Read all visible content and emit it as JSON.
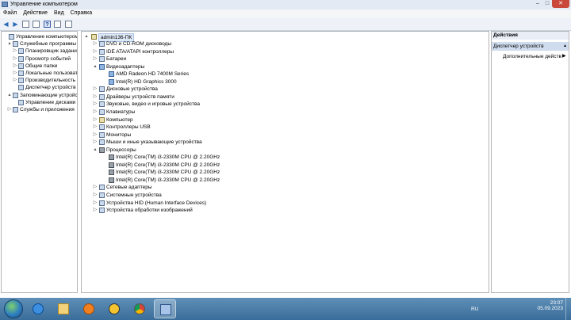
{
  "window": {
    "title": "Управление компьютером"
  },
  "menu": [
    "Файл",
    "Действие",
    "Вид",
    "Справка"
  ],
  "left_tree": [
    {
      "label": "Управление компьютером (л",
      "exp": "",
      "level": 0
    },
    {
      "label": "Служебные программы",
      "exp": "▴",
      "level": 1
    },
    {
      "label": "Планировщик заданий",
      "exp": "▷",
      "level": 2
    },
    {
      "label": "Просмотр событий",
      "exp": "▷",
      "level": 2
    },
    {
      "label": "Общие папки",
      "exp": "▷",
      "level": 2
    },
    {
      "label": "Локальные пользовате",
      "exp": "▷",
      "level": 2
    },
    {
      "label": "Производительность",
      "exp": "▷",
      "level": 2
    },
    {
      "label": "Диспетчер устройств",
      "exp": "",
      "level": 2
    },
    {
      "label": "Запоминающие устройств",
      "exp": "▴",
      "level": 1
    },
    {
      "label": "Управление дисками",
      "exp": "",
      "level": 2
    },
    {
      "label": "Службы и приложения",
      "exp": "▷",
      "level": 1
    }
  ],
  "device_tree": {
    "root": "admin136-ПК",
    "items": [
      {
        "label": "DVD и CD-ROM дисководы",
        "exp": "▷",
        "level": 1,
        "icon": "dvd-drive-icon"
      },
      {
        "label": "IDE ATA/ATAPI контроллеры",
        "exp": "▷",
        "level": 1,
        "icon": "ide-controller-icon"
      },
      {
        "label": "Батареи",
        "exp": "▷",
        "level": 1,
        "icon": "battery-icon"
      },
      {
        "label": "Видеоадаптеры",
        "exp": "▴",
        "level": 1,
        "icon": "display-adapter-icon"
      },
      {
        "label": "AMD Radeon HD 7400M Series",
        "exp": "",
        "level": 2,
        "icon": "display-adapter-icon"
      },
      {
        "label": "Intel(R) HD Graphics 3000",
        "exp": "",
        "level": 2,
        "icon": "display-adapter-icon"
      },
      {
        "label": "Дисковые устройства",
        "exp": "▷",
        "level": 1,
        "icon": "disk-drive-icon"
      },
      {
        "label": "Драйверы устройств памяти",
        "exp": "▷",
        "level": 1,
        "icon": "memory-device-icon"
      },
      {
        "label": "Звуковые, видео и игровые устройства",
        "exp": "▷",
        "level": 1,
        "icon": "sound-device-icon"
      },
      {
        "label": "Клавиатуры",
        "exp": "▷",
        "level": 1,
        "icon": "keyboard-icon"
      },
      {
        "label": "Компьютер",
        "exp": "▷",
        "level": 1,
        "icon": "computer-icon"
      },
      {
        "label": "Контроллеры USB",
        "exp": "▷",
        "level": 1,
        "icon": "usb-controller-icon"
      },
      {
        "label": "Мониторы",
        "exp": "▷",
        "level": 1,
        "icon": "monitor-icon"
      },
      {
        "label": "Мыши и иные указывающие устройства",
        "exp": "▷",
        "level": 1,
        "icon": "mouse-icon"
      },
      {
        "label": "Процессоры",
        "exp": "▴",
        "level": 1,
        "icon": "processor-icon"
      },
      {
        "label": "Intel(R) Core(TM) i3-2330M CPU @ 2.20GHz",
        "exp": "",
        "level": 2,
        "icon": "processor-icon"
      },
      {
        "label": "Intel(R) Core(TM) i3-2330M CPU @ 2.20GHz",
        "exp": "",
        "level": 2,
        "icon": "processor-icon"
      },
      {
        "label": "Intel(R) Core(TM) i3-2330M CPU @ 2.20GHz",
        "exp": "",
        "level": 2,
        "icon": "processor-icon"
      },
      {
        "label": "Intel(R) Core(TM) i3-2330M CPU @ 2.20GHz",
        "exp": "",
        "level": 2,
        "icon": "processor-icon"
      },
      {
        "label": "Сетевые адаптеры",
        "exp": "▷",
        "level": 1,
        "icon": "network-adapter-icon"
      },
      {
        "label": "Системные устройства",
        "exp": "▷",
        "level": 1,
        "icon": "system-device-icon"
      },
      {
        "label": "Устройства HID (Human Interface Devices)",
        "exp": "▷",
        "level": 1,
        "icon": "hid-device-icon"
      },
      {
        "label": "Устройства обработки изображений",
        "exp": "▷",
        "level": 1,
        "icon": "imaging-device-icon"
      }
    ]
  },
  "actions": {
    "header": "Действия",
    "section": "Диспетчер устройств",
    "item": "Дополнительные действ"
  },
  "taskbar": {
    "lang": "RU",
    "time": "23:07",
    "date": "05.09.2023"
  },
  "colors": {
    "selection": "#dde8f6",
    "taskbar": "#3a6d99",
    "close": "#c9473b"
  }
}
